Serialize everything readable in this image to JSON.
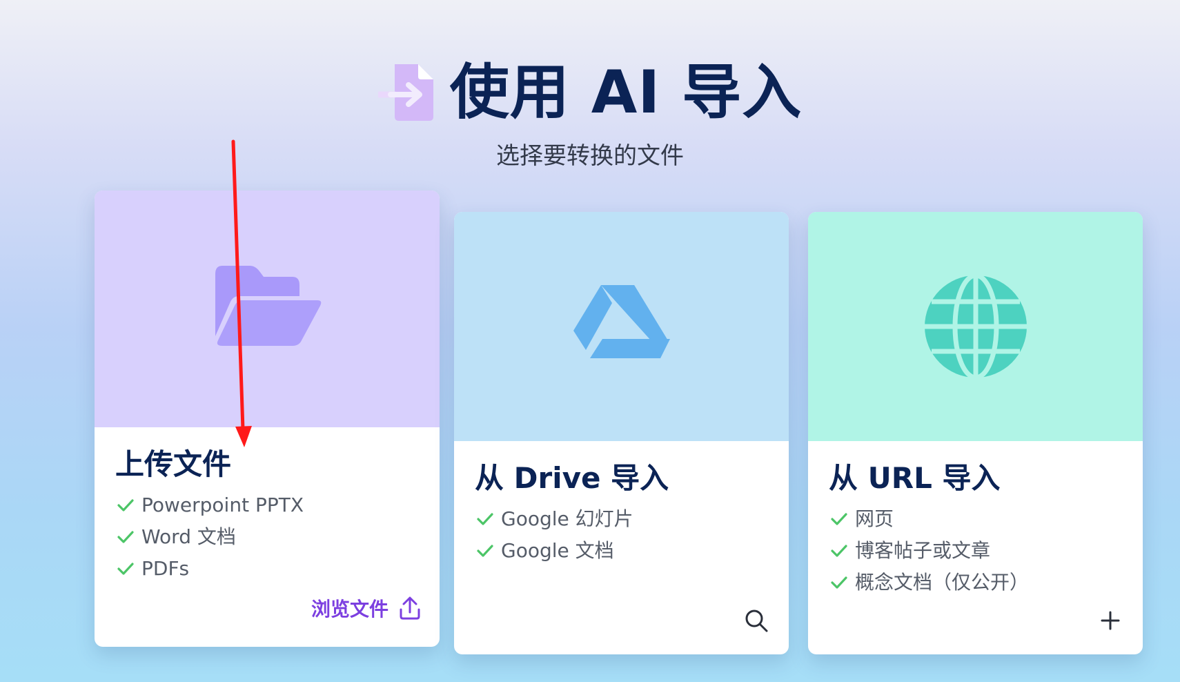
{
  "header": {
    "title": "使用 AI 导入",
    "subtitle": "选择要转换的文件",
    "icon": "file-import-icon"
  },
  "cards": [
    {
      "id": "upload",
      "title": "上传文件",
      "icon": "folder-open-icon",
      "features": [
        "Powerpoint PPTX",
        "Word 文档",
        "PDFs"
      ],
      "action_label": "浏览文件",
      "action_icon": "upload-icon"
    },
    {
      "id": "drive",
      "title": "从 Drive 导入",
      "icon": "google-drive-icon",
      "features": [
        "Google 幻灯片",
        "Google 文档"
      ],
      "action_icon": "search-icon"
    },
    {
      "id": "url",
      "title": "从 URL 导入",
      "icon": "globe-icon",
      "features": [
        "网页",
        "博客帖子或文章",
        "概念文档（仅公开）"
      ],
      "action_icon": "plus-icon"
    }
  ],
  "colors": {
    "title": "#0b2355",
    "accent_purple": "#7c3fe0",
    "check_green": "#4cc567",
    "upload_bg": "#d8d0fd",
    "drive_bg": "#bde1f7",
    "url_bg": "#b0f4e6",
    "annotation_arrow": "#ff1a1a"
  }
}
